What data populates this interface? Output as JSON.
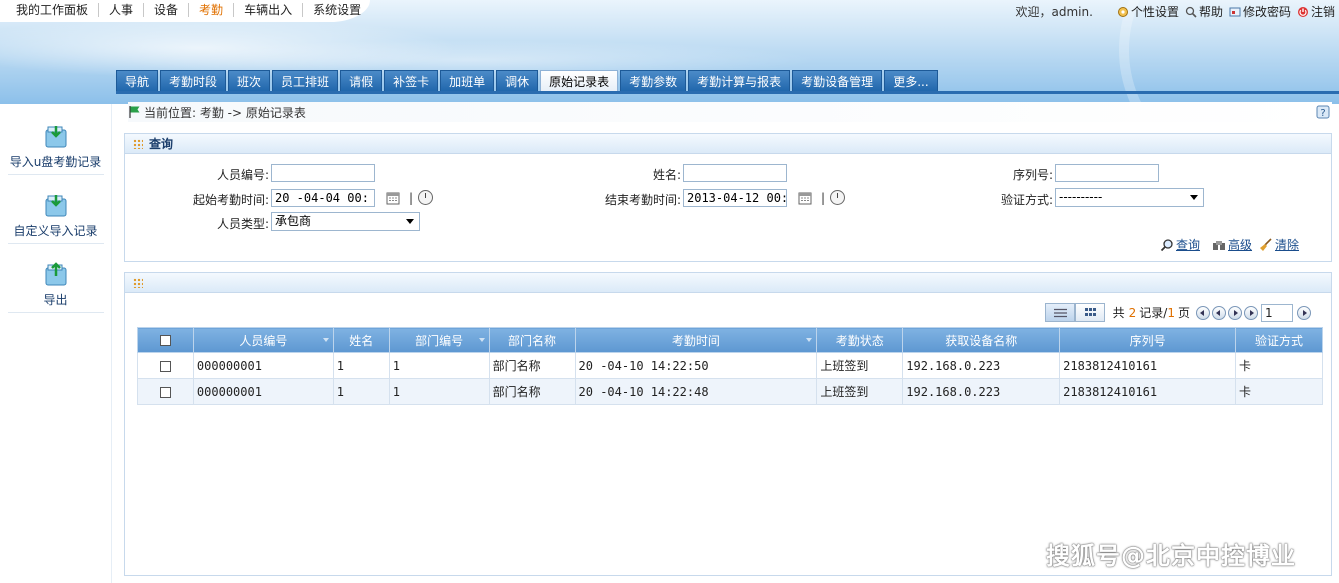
{
  "top_nav": [
    "我的工作面板",
    "人事",
    "设备",
    "考勤",
    "车辆出入",
    "系统设置"
  ],
  "top_nav_active": "考勤",
  "user_bar": {
    "welcome": "欢迎，admin.",
    "links": [
      {
        "label": "个性设置",
        "icon": "personal-settings-icon"
      },
      {
        "label": "帮助",
        "icon": "help-icon"
      },
      {
        "label": "修改密码",
        "icon": "change-password-icon"
      },
      {
        "label": "注销",
        "icon": "logout-icon"
      }
    ]
  },
  "tabs": [
    "导航",
    "考勤时段",
    "班次",
    "员工排班",
    "请假",
    "补签卡",
    "加班单",
    "调休",
    "原始记录表",
    "考勤参数",
    "考勤计算与报表",
    "考勤设备管理",
    "更多..."
  ],
  "active_tab": "原始记录表",
  "left_panel": [
    {
      "label": "导入u盘考勤记录",
      "icon": "import-usb-icon"
    },
    {
      "label": "自定义导入记录",
      "icon": "custom-import-icon"
    },
    {
      "label": "导出",
      "icon": "export-icon"
    }
  ],
  "breadcrumb": "当前位置: 考勤 -> 原始记录表",
  "query": {
    "title": "查询",
    "emp_no_label": "人员编号:",
    "name_label": "姓名:",
    "serial_label": "序列号:",
    "start_label": "起始考勤时间:",
    "start_value": "20    -04-04 00:",
    "end_label": "结束考勤时间:",
    "end_value": "2013-04-12 00:",
    "verify_label": "验证方式:",
    "verify_value": "----------",
    "type_label": "人员类型:",
    "type_value": "承包商",
    "separator": "|",
    "actions": {
      "search": "查询",
      "advanced": "高级",
      "clear": "清除"
    }
  },
  "pager": {
    "prefix": "共",
    "total": "2",
    "records_label": "记录/",
    "pages": "1",
    "pages_suffix": "页",
    "current_page": "1"
  },
  "table": {
    "columns": [
      "",
      "人员编号",
      "姓名",
      "部门编号",
      "部门名称",
      "考勤时间",
      "考勤状态",
      "获取设备名称",
      "序列号",
      "验证方式"
    ],
    "rows": [
      [
        "000000001",
        "1",
        "1",
        "部门名称",
        "20    -04-10 14:22:50",
        "上班签到",
        "192.168.0.223",
        "2183812410161",
        "卡"
      ],
      [
        "000000001",
        "1",
        "1",
        "部门名称",
        "20    -04-10 14:22:48",
        "上班签到",
        "192.168.0.223",
        "2183812410161",
        "卡"
      ]
    ]
  },
  "watermark": "搜狐号@北京中控博业",
  "colors": {
    "tab_blue": "#2a6cb0",
    "active_nav": "#e07000",
    "grid_header": "#6aa3d8",
    "page_count": "#e07000"
  }
}
